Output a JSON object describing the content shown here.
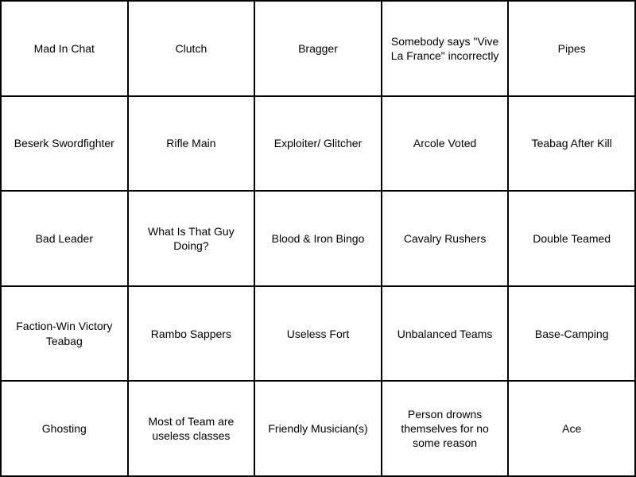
{
  "grid": {
    "cells": [
      {
        "id": "r0c0",
        "text": "Mad In Chat"
      },
      {
        "id": "r0c1",
        "text": "Clutch"
      },
      {
        "id": "r0c2",
        "text": "Bragger"
      },
      {
        "id": "r0c3",
        "text": "Somebody says \"Vive La France\" incorrectly"
      },
      {
        "id": "r0c4",
        "text": "Pipes"
      },
      {
        "id": "r1c0",
        "text": "Beserk Swordfighter"
      },
      {
        "id": "r1c1",
        "text": "Rifle Main"
      },
      {
        "id": "r1c2",
        "text": "Exploiter/ Glitcher"
      },
      {
        "id": "r1c3",
        "text": "Arcole Voted"
      },
      {
        "id": "r1c4",
        "text": "Teabag After Kill"
      },
      {
        "id": "r2c0",
        "text": "Bad Leader"
      },
      {
        "id": "r2c1",
        "text": "What Is That Guy Doing?"
      },
      {
        "id": "r2c2",
        "text": "Blood & Iron Bingo"
      },
      {
        "id": "r2c3",
        "text": "Cavalry Rushers"
      },
      {
        "id": "r2c4",
        "text": "Double Teamed"
      },
      {
        "id": "r3c0",
        "text": "Faction-Win Victory Teabag"
      },
      {
        "id": "r3c1",
        "text": "Rambo Sappers"
      },
      {
        "id": "r3c2",
        "text": "Useless Fort"
      },
      {
        "id": "r3c3",
        "text": "Unbalanced Teams"
      },
      {
        "id": "r3c4",
        "text": "Base-Camping"
      },
      {
        "id": "r4c0",
        "text": "Ghosting"
      },
      {
        "id": "r4c1",
        "text": "Most of Team are useless classes"
      },
      {
        "id": "r4c2",
        "text": "Friendly Musician(s)"
      },
      {
        "id": "r4c3",
        "text": "Person drowns themselves for no some reason"
      },
      {
        "id": "r4c4",
        "text": "Ace"
      }
    ]
  }
}
